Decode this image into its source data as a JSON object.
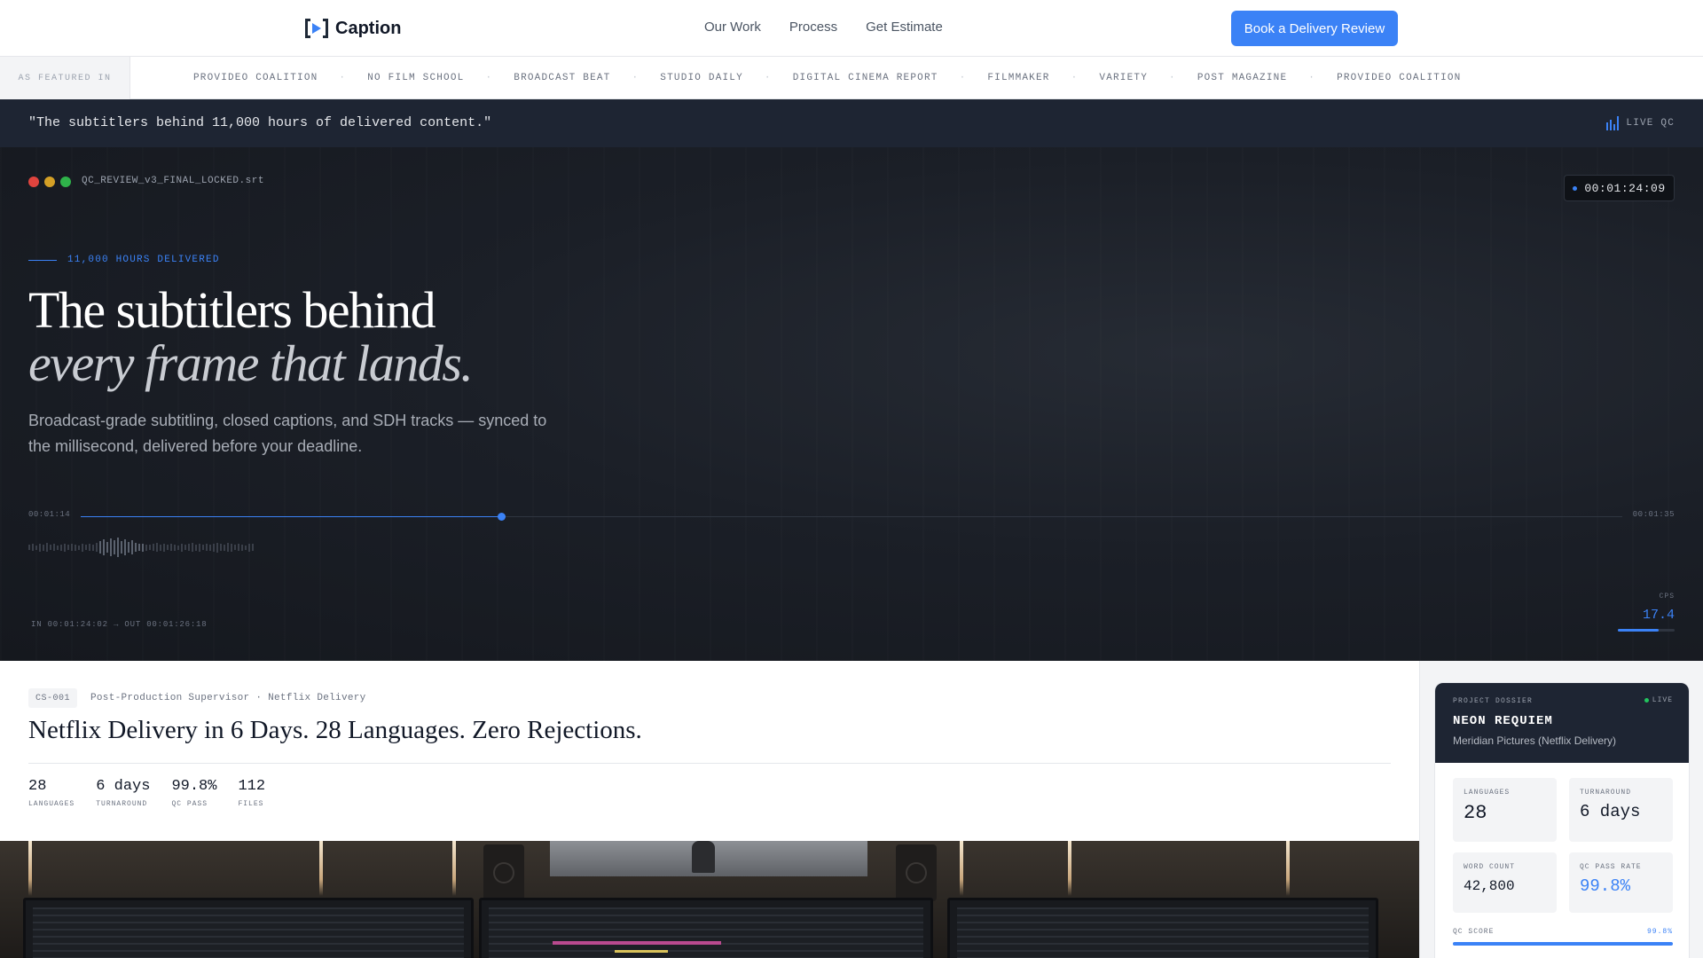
{
  "nav": {
    "brand": "Caption",
    "links": [
      "Our Work",
      "Process",
      "Get Estimate"
    ],
    "cta": "Book a Delivery Review"
  },
  "featured": {
    "label": "AS FEATURED IN",
    "items": [
      "PROVIDEO COALITION",
      "NO FILM SCHOOL",
      "BROADCAST BEAT",
      "STUDIO DAILY",
      "DIGITAL CINEMA REPORT",
      "FILMMAKER",
      "VARIETY",
      "POST MAGAZINE",
      "PROVIDEO COALITION"
    ],
    "separator": "·"
  },
  "quote_bar": {
    "quote": "\"The subtitlers behind 11,000 hours of delivered content.\"",
    "status": "LIVE QC"
  },
  "hero": {
    "filename": "QC_REVIEW_v3_FINAL_LOCKED.srt",
    "timecode": "00:01:24:09",
    "eyebrow": "11,000 HOURS DELIVERED",
    "title_line1": "The subtitlers behind",
    "title_line2": "every frame that lands.",
    "subtitle": "Broadcast-grade subtitling, closed captions, and SDH tracks — synced to the millisecond, delivered before your deadline.",
    "timeline": {
      "start": "00:01:14",
      "end": "00:01:35",
      "progress": 0.273
    },
    "in_out": "IN 00:01:24:02 → OUT 00:01:26:18",
    "cps_label": "CPS",
    "cps_value": "17.4",
    "cps_level": 0.72,
    "colors": {
      "accent": "#3b82f6",
      "dot_red": "#e0443e",
      "dot_yellow": "#d4a026",
      "dot_green": "#2fb34a"
    }
  },
  "case": {
    "tag": "CS-001",
    "meta": "Post-Production Supervisor · Netflix Delivery",
    "title": "Netflix Delivery in 6 Days. 28 Languages. Zero Rejections.",
    "stats": [
      {
        "value": "28",
        "label": "LANGUAGES"
      },
      {
        "value": "6 days",
        "label": "TURNAROUND"
      },
      {
        "value": "99.8%",
        "label": "QC PASS"
      },
      {
        "value": "112",
        "label": "FILES"
      }
    ]
  },
  "dossier": {
    "label": "PROJECT DOSSIER",
    "live": "LIVE",
    "name": "NEON REQUIEM",
    "client": "Meridian Pictures (Netflix Delivery)",
    "cells": [
      {
        "key": "LANGUAGES",
        "value": "28"
      },
      {
        "key": "TURNAROUND",
        "value": "6 days"
      },
      {
        "key": "WORD COUNT",
        "value": "42,800"
      },
      {
        "key": "QC PASS RATE",
        "value": "99.8%"
      }
    ],
    "qc_label": "QC SCORE",
    "qc_value": "99.8%",
    "qc_level": 0.998
  }
}
